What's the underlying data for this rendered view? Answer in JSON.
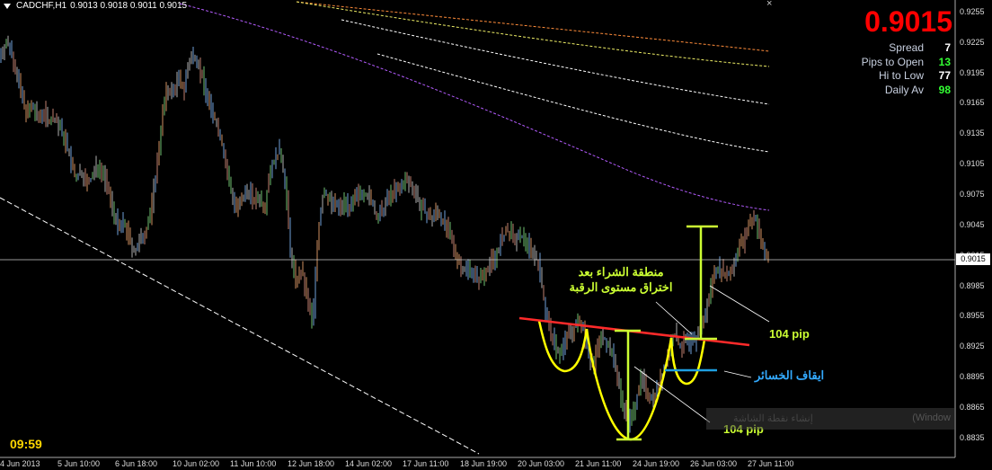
{
  "window": {
    "symbol": "CADCHF,H1",
    "ohlc": "0.9013 0.9018 0.9011 0.9015",
    "close_glyph": "×"
  },
  "hud": {
    "price": "0.9015",
    "stats": [
      {
        "label": "Spread",
        "value": "7",
        "color": "#ffffff"
      },
      {
        "label": "Pips to Open",
        "value": "13",
        "color": "#33ff33"
      },
      {
        "label": "Hi to Low",
        "value": "77",
        "color": "#ffffff"
      },
      {
        "label": "Daily Av",
        "value": "98",
        "color": "#33ff33"
      }
    ],
    "clock": "09:59"
  },
  "annotations": {
    "buy_zone_line1": "منطقة الشراء بعد",
    "buy_zone_line2": "اختراق مستوى الرقبة",
    "target_pips_top": "104 pip",
    "target_pips_bottom": "104 pip",
    "stop_loss": "ايقاف الخسائر",
    "window_text": "(Window",
    "window_text2": "إنشاء نقطة الشاشة"
  },
  "colors": {
    "neckline": "#ff2a2a",
    "pattern": "#ffff00",
    "measure": "#ccff33",
    "stop": "#1e9fe0",
    "label_green": "#ccff33",
    "label_blue": "#33aaff"
  },
  "chart_data": {
    "type": "candlestick",
    "y_ticks": [
      "0.9255",
      "0.9225",
      "0.9195",
      "0.9165",
      "0.9135",
      "0.9105",
      "0.9075",
      "0.9045",
      "0.9015",
      "0.8985",
      "0.8955",
      "0.8925",
      "0.8895",
      "0.8865",
      "0.8835"
    ],
    "current_price": "0.9015",
    "x_ticks": [
      "4 Jun 2013",
      "5 Jun 10:00",
      "6 Jun 18:00",
      "10 Jun 02:00",
      "11 Jun 10:00",
      "12 Jun 18:00",
      "14 Jun 02:00",
      "17 Jun 11:00",
      "18 Jun 19:00",
      "20 Jun 03:00",
      "21 Jun 11:00",
      "24 Jun 19:00",
      "26 Jun 03:00",
      "27 Jun 11:00"
    ],
    "ylim": [
      0.8826,
      0.9262
    ],
    "close_path": [
      [
        0,
        0.9212
      ],
      [
        6,
        0.9225
      ],
      [
        12,
        0.922
      ],
      [
        18,
        0.9195
      ],
      [
        24,
        0.9172
      ],
      [
        30,
        0.9155
      ],
      [
        36,
        0.9162
      ],
      [
        42,
        0.915
      ],
      [
        48,
        0.9158
      ],
      [
        54,
        0.9148
      ],
      [
        60,
        0.9152
      ],
      [
        66,
        0.9142
      ],
      [
        72,
        0.913
      ],
      [
        78,
        0.911
      ],
      [
        84,
        0.909
      ],
      [
        90,
        0.91
      ],
      [
        96,
        0.9085
      ],
      [
        102,
        0.9092
      ],
      [
        108,
        0.9105
      ],
      [
        114,
        0.9098
      ],
      [
        120,
        0.908
      ],
      [
        126,
        0.906
      ],
      [
        132,
        0.904
      ],
      [
        138,
        0.9048
      ],
      [
        144,
        0.903
      ],
      [
        150,
        0.9018
      ],
      [
        156,
        0.903
      ],
      [
        162,
        0.904
      ],
      [
        168,
        0.906
      ],
      [
        174,
        0.91
      ],
      [
        180,
        0.915
      ],
      [
        186,
        0.918
      ],
      [
        192,
        0.9175
      ],
      [
        198,
        0.919
      ],
      [
        204,
        0.9178
      ],
      [
        210,
        0.9205
      ],
      [
        216,
        0.9215
      ],
      [
        222,
        0.92
      ],
      [
        228,
        0.918
      ],
      [
        234,
        0.916
      ],
      [
        240,
        0.9148
      ],
      [
        246,
        0.913
      ],
      [
        252,
        0.91
      ],
      [
        258,
        0.9075
      ],
      [
        264,
        0.906
      ],
      [
        270,
        0.907
      ],
      [
        276,
        0.9082
      ],
      [
        282,
        0.9068
      ],
      [
        288,
        0.9075
      ],
      [
        294,
        0.906
      ],
      [
        300,
        0.91
      ],
      [
        306,
        0.911
      ],
      [
        312,
        0.912
      ],
      [
        318,
        0.908
      ],
      [
        324,
        0.901
      ],
      [
        330,
        0.899
      ],
      [
        336,
        0.9
      ],
      [
        342,
        0.897
      ],
      [
        348,
        0.895
      ],
      [
        354,
        0.904
      ],
      [
        360,
        0.908
      ],
      [
        366,
        0.907
      ],
      [
        372,
        0.9065
      ],
      [
        378,
        0.9062
      ],
      [
        384,
        0.907
      ],
      [
        390,
        0.906
      ],
      [
        396,
        0.9072
      ],
      [
        402,
        0.908
      ],
      [
        408,
        0.9075
      ],
      [
        414,
        0.9068
      ],
      [
        420,
        0.905
      ],
      [
        426,
        0.906
      ],
      [
        432,
        0.9072
      ],
      [
        438,
        0.908
      ],
      [
        444,
        0.9078
      ],
      [
        450,
        0.909
      ],
      [
        456,
        0.9086
      ],
      [
        462,
        0.908
      ],
      [
        468,
        0.9062
      ],
      [
        474,
        0.9058
      ],
      [
        480,
        0.905
      ],
      [
        486,
        0.906
      ],
      [
        492,
        0.905
      ],
      [
        498,
        0.904
      ],
      [
        504,
        0.9025
      ],
      [
        510,
        0.901
      ],
      [
        516,
        0.9
      ],
      [
        522,
        0.9005
      ],
      [
        528,
        0.8995
      ],
      [
        534,
        0.8992
      ],
      [
        540,
        0.9
      ],
      [
        546,
        0.901
      ],
      [
        552,
        0.9015
      ],
      [
        558,
        0.903
      ],
      [
        564,
        0.904
      ],
      [
        570,
        0.9035
      ],
      [
        576,
        0.903
      ],
      [
        582,
        0.9035
      ],
      [
        588,
        0.9025
      ],
      [
        594,
        0.9018
      ],
      [
        600,
        0.9005
      ],
      [
        606,
        0.8965
      ],
      [
        612,
        0.894
      ],
      [
        618,
        0.8925
      ],
      [
        624,
        0.8918
      ],
      [
        630,
        0.8935
      ],
      [
        636,
        0.894
      ],
      [
        642,
        0.8948
      ],
      [
        648,
        0.895
      ],
      [
        654,
        0.892
      ],
      [
        660,
        0.8905
      ],
      [
        666,
        0.893
      ],
      [
        672,
        0.8935
      ],
      [
        678,
        0.8925
      ],
      [
        684,
        0.891
      ],
      [
        690,
        0.888
      ],
      [
        696,
        0.886
      ],
      [
        702,
        0.885
      ],
      [
        708,
        0.8875
      ],
      [
        714,
        0.8895
      ],
      [
        720,
        0.888
      ],
      [
        726,
        0.8875
      ],
      [
        732,
        0.8885
      ],
      [
        738,
        0.89
      ],
      [
        744,
        0.892
      ],
      [
        750,
        0.894
      ],
      [
        756,
        0.8925
      ],
      [
        762,
        0.893
      ],
      [
        768,
        0.8928
      ],
      [
        774,
        0.8932
      ],
      [
        780,
        0.8945
      ],
      [
        786,
        0.896
      ],
      [
        792,
        0.899
      ],
      [
        798,
        0.9005
      ],
      [
        804,
        0.9
      ],
      [
        810,
        0.8995
      ],
      [
        816,
        0.9005
      ],
      [
        822,
        0.9025
      ],
      [
        828,
        0.903
      ],
      [
        834,
        0.9048
      ],
      [
        840,
        0.9055
      ],
      [
        846,
        0.903
      ],
      [
        852,
        0.9015
      ],
      [
        856,
        0.9015
      ]
    ]
  }
}
